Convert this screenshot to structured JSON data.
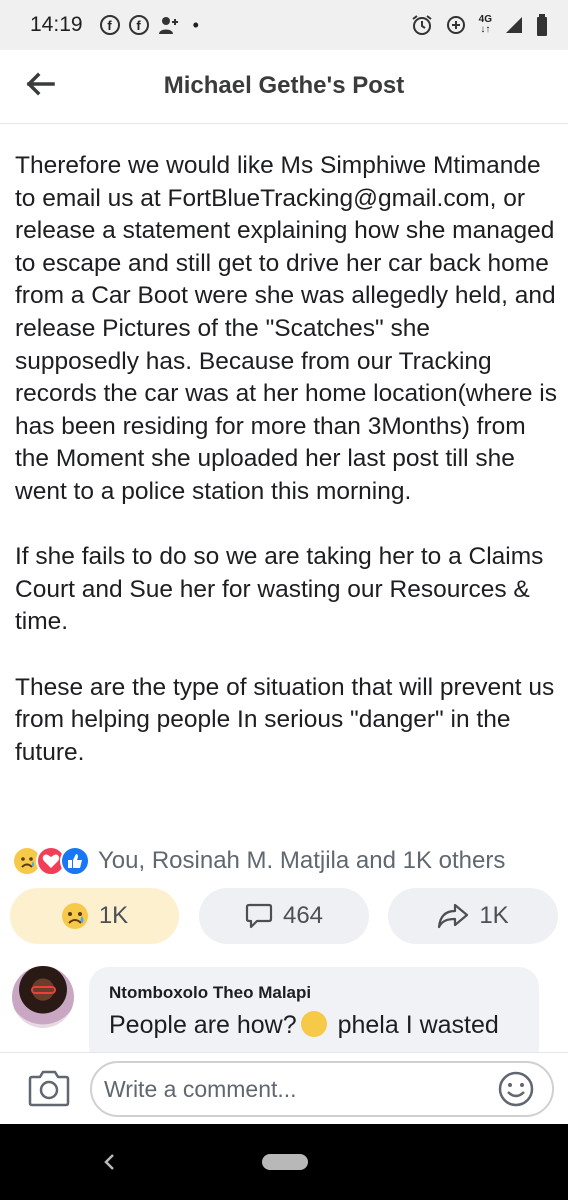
{
  "status_bar": {
    "time": "14:19",
    "fb_glyph": "f",
    "network": "4G",
    "icons": [
      "facebook-icon",
      "facebook-icon",
      "add-person-icon",
      "dot-icon",
      "alarm-icon",
      "data-saver-icon",
      "4g-icon",
      "signal-icon",
      "battery-icon"
    ]
  },
  "header": {
    "title": "Michael Gethe's Post",
    "back_icon": "arrow-left-icon"
  },
  "post": {
    "body": "Therefore we would like Ms Simphiwe Mtimande to email us at FortBlueTracking@gmail.com, or release a statement explaining how she managed to escape and still get to drive her car back home from a Car Boot were she was allegedly held, and release Pictures of the \"Scatches\" she supposedly has. Because from our Tracking records the car was at her home location(where is has been residing for more than 3Months) from the Moment she uploaded her last post till she went to a police station this morning.\n\nIf she fails to do so we are taking her to a Claims Court and Sue her for wasting our Resources & time.\n\nThese are the type of situation that will prevent us from helping people In serious \"danger\" in the future."
  },
  "reactions": {
    "icons": [
      "sad-reaction-icon",
      "love-reaction-icon",
      "like-reaction-icon"
    ],
    "summary": "You, Rosinah M. Matjila and 1K others"
  },
  "actions": {
    "react_count": "1K",
    "comment_count": "464",
    "share_count": "1K"
  },
  "comment": {
    "author": "Ntomboxolo Theo Malapi",
    "text_before": "People are how?",
    "text_after": " phela I wasted"
  },
  "composer": {
    "placeholder": "Write a comment..."
  },
  "colors": {
    "accent": "#1877f2",
    "react_pill_bg": "#fdf0cf",
    "pill_bg": "#eff0f3",
    "status_bar_bg": "#f0f0f0",
    "nav_bar_bg": "#000000"
  }
}
